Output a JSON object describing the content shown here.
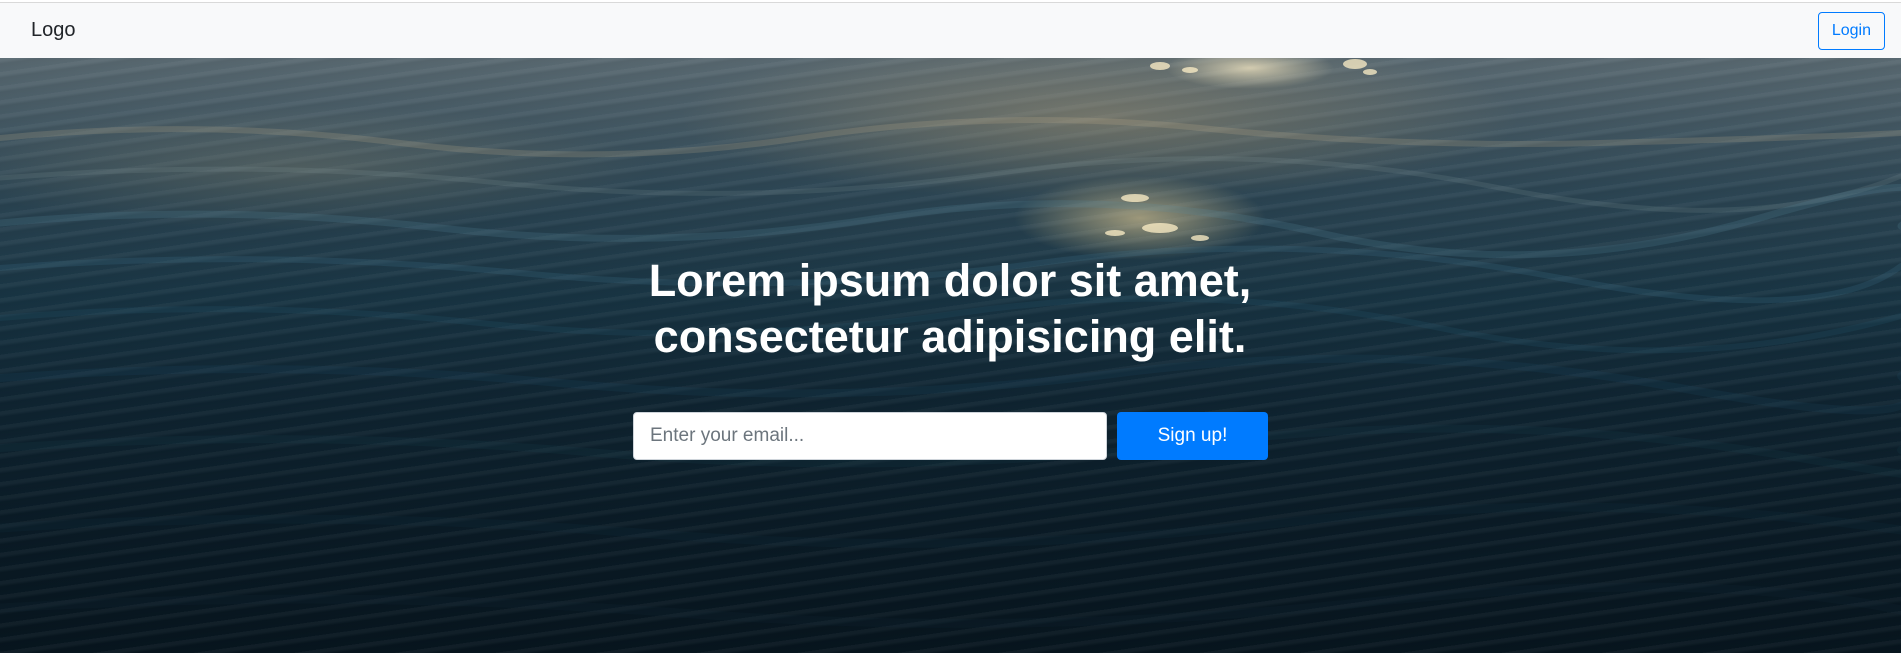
{
  "navbar": {
    "logo_text": "Logo",
    "login_label": "Login"
  },
  "hero": {
    "headline_line1": "Lorem ipsum dolor sit amet,",
    "headline_line2": "consectetur adipisicing elit.",
    "email_placeholder": "Enter your email...",
    "email_value": "",
    "signup_label": "Sign up!"
  },
  "colors": {
    "accent": "#007bff",
    "navbar_bg": "#f8f9fa",
    "headline_text": "#ffffff"
  }
}
